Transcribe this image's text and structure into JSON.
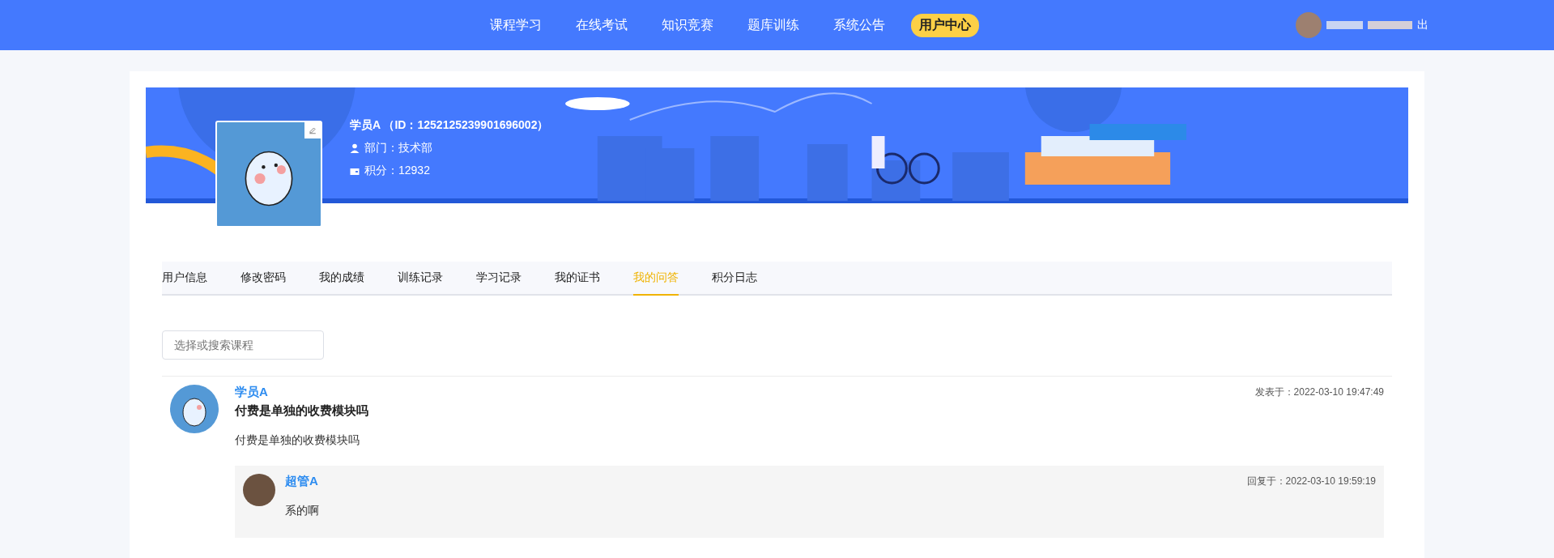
{
  "nav": {
    "items": [
      {
        "label": "课程学习",
        "selected": false
      },
      {
        "label": "在线考试",
        "selected": false
      },
      {
        "label": "知识竞赛",
        "selected": false
      },
      {
        "label": "题库训练",
        "selected": false
      },
      {
        "label": "系统公告",
        "selected": false
      },
      {
        "label": "用户中心",
        "selected": true
      }
    ],
    "logout": "出"
  },
  "profile": {
    "name_line": "学员A （ID：1252125239901696002）",
    "department": "部门：技术部",
    "points": "积分：12932"
  },
  "tabs": [
    {
      "label": "用户信息",
      "selected": false
    },
    {
      "label": "修改密码",
      "selected": false
    },
    {
      "label": "我的成绩",
      "selected": false
    },
    {
      "label": "训练记录",
      "selected": false
    },
    {
      "label": "学习记录",
      "selected": false
    },
    {
      "label": "我的证书",
      "selected": false
    },
    {
      "label": "我的问答",
      "selected": true
    },
    {
      "label": "积分日志",
      "selected": false
    }
  ],
  "search": {
    "placeholder": "选择或搜索课程"
  },
  "questions": [
    {
      "author": "学员A",
      "title": "付费是单独的收费模块吗",
      "body": "付费是单独的收费模块吗",
      "posted": "发表于：2022-03-10 19:47:49",
      "replies": [
        {
          "author": "超管A",
          "body": "系的啊",
          "replied": "回复于：2022-03-10 19:59:19"
        }
      ]
    }
  ]
}
